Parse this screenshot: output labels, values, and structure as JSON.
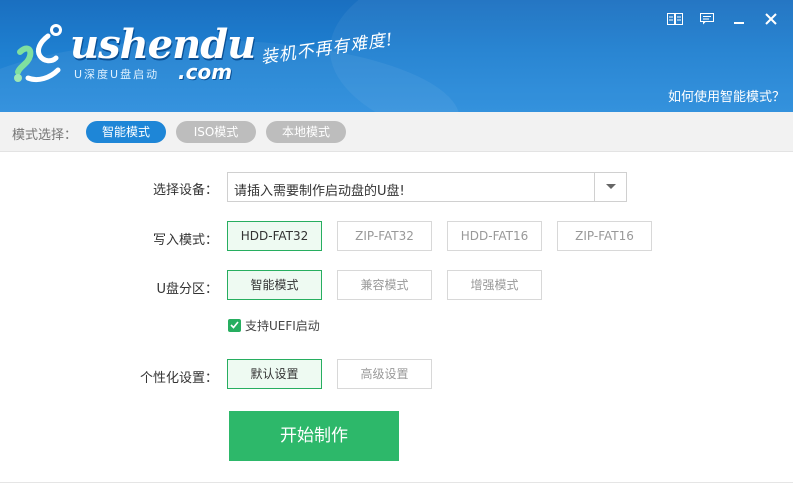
{
  "header": {
    "logo_text": "ushendu",
    "logo_sub": "U深度U盘启动",
    "logo_com": ".com",
    "slogan": "装机不再有难度!",
    "help_link": "如何使用智能模式？",
    "colors": {
      "bg": "#1e7fd0"
    }
  },
  "window_controls": {
    "icons": [
      "book-icon",
      "message-icon",
      "minimize-icon",
      "close-icon"
    ]
  },
  "mode_bar": {
    "label": "模式选择：",
    "modes": [
      {
        "label": "智能模式",
        "active": true
      },
      {
        "label": "ISO模式",
        "active": false
      },
      {
        "label": "本地模式",
        "active": false
      }
    ],
    "accent": "#1e86d7"
  },
  "form": {
    "device_label": "选择设备：",
    "device_value": "请插入需要制作启动盘的U盘!",
    "write_label": "写入模式：",
    "write_modes": [
      "HDD-FAT32",
      "ZIP-FAT32",
      "HDD-FAT16",
      "ZIP-FAT16"
    ],
    "partition_label": "U盘分区：",
    "partition_modes": [
      "智能模式",
      "兼容模式",
      "增强模式"
    ],
    "uefi_label": "支持UEFI启动",
    "uefi_checked": true,
    "personal_label": "个性化设置：",
    "personal_modes": [
      "默认设置",
      "高级设置"
    ],
    "start_label": "开始制作",
    "selected_color": "#27ae60"
  }
}
